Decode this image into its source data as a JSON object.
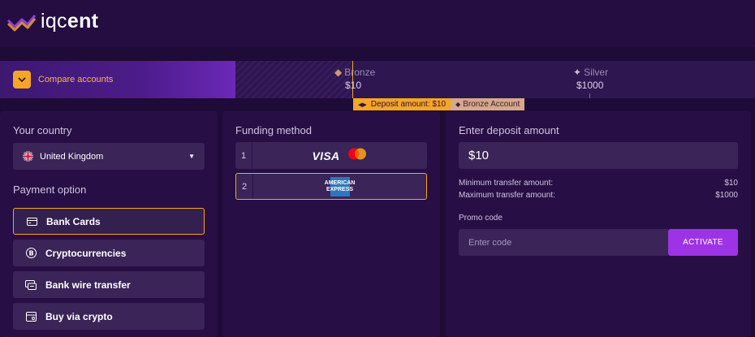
{
  "header": {
    "logo_text_light": "iqc",
    "logo_text_bold1": "e",
    "logo_text_bold2": "nt"
  },
  "progress": {
    "compare_label": "Compare accounts",
    "levels": [
      {
        "name": "Bronze",
        "value": "$10"
      },
      {
        "name": "Silver",
        "value": "$1000"
      }
    ],
    "deposit_tag": "Deposit amount: $10",
    "account_tag": "Bronze Account"
  },
  "country": {
    "label": "Your country",
    "value": "United Kingdom"
  },
  "payment": {
    "label": "Payment option",
    "options": [
      {
        "label": "Bank Cards",
        "icon": "card-icon",
        "selected": true
      },
      {
        "label": "Cryptocurrencies",
        "icon": "bitcoin-icon",
        "selected": false
      },
      {
        "label": "Bank wire transfer",
        "icon": "bank-transfer-icon",
        "selected": false
      },
      {
        "label": "Buy via crypto",
        "icon": "crypto-card-icon",
        "selected": false
      }
    ]
  },
  "funding": {
    "label": "Funding method",
    "methods": [
      {
        "num": "1",
        "brand": "VISA",
        "icons": [
          "visa-logo",
          "mastercard-logo"
        ]
      },
      {
        "num": "2",
        "brand_line1": "AMERICAN",
        "brand_line2": "EXPRESS",
        "icons": [
          "amex-logo"
        ]
      }
    ]
  },
  "deposit": {
    "label": "Enter deposit amount",
    "value": "$10",
    "min_label": "Minimum transfer amount:",
    "min_value": "$10",
    "max_label": "Maximum transfer amount:",
    "max_value": "$1000",
    "promo_label": "Promo code",
    "promo_placeholder": "Enter code",
    "activate_label": "ACTIVATE"
  },
  "colors": {
    "accent": "#f5a623",
    "activate": "#9e33e6",
    "background": "#1e0b37",
    "panel": "#270f45"
  }
}
